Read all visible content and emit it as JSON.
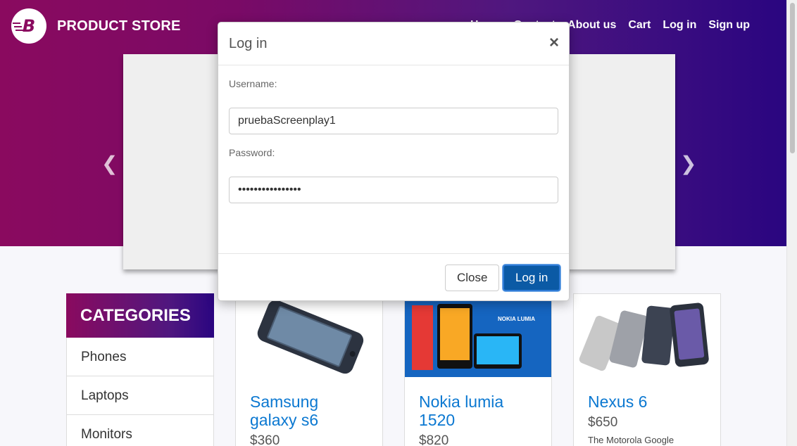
{
  "brand": {
    "name": "PRODUCT STORE",
    "logo_letter": "B"
  },
  "nav": {
    "items": [
      "Home",
      "Contact",
      "About us",
      "Cart",
      "Log in",
      "Sign up"
    ]
  },
  "carousel": {
    "prev_icon": "chevron-left-icon",
    "next_icon": "chevron-right-icon"
  },
  "categories": {
    "title": "CATEGORIES",
    "items": [
      "Phones",
      "Laptops",
      "Monitors"
    ]
  },
  "products": [
    {
      "title": "Samsung galaxy s6",
      "price": "$360",
      "desc": ""
    },
    {
      "title": "Nokia lumia 1520",
      "price": "$820",
      "desc": ""
    },
    {
      "title": "Nexus 6",
      "price": "$650",
      "desc": "The Motorola Google"
    }
  ],
  "modal": {
    "title": "Log in",
    "close_icon": "close-icon",
    "username_label": "Username:",
    "username_value": "pruebaScreenplay1",
    "password_label": "Password:",
    "password_value": "••••••••••••••••",
    "close_button": "Close",
    "login_button": "Log in"
  },
  "colors": {
    "brand_start": "#8a0a5f",
    "brand_end": "#2a0580",
    "link": "#0b78d1",
    "primary_button": "#0b5aa5"
  }
}
